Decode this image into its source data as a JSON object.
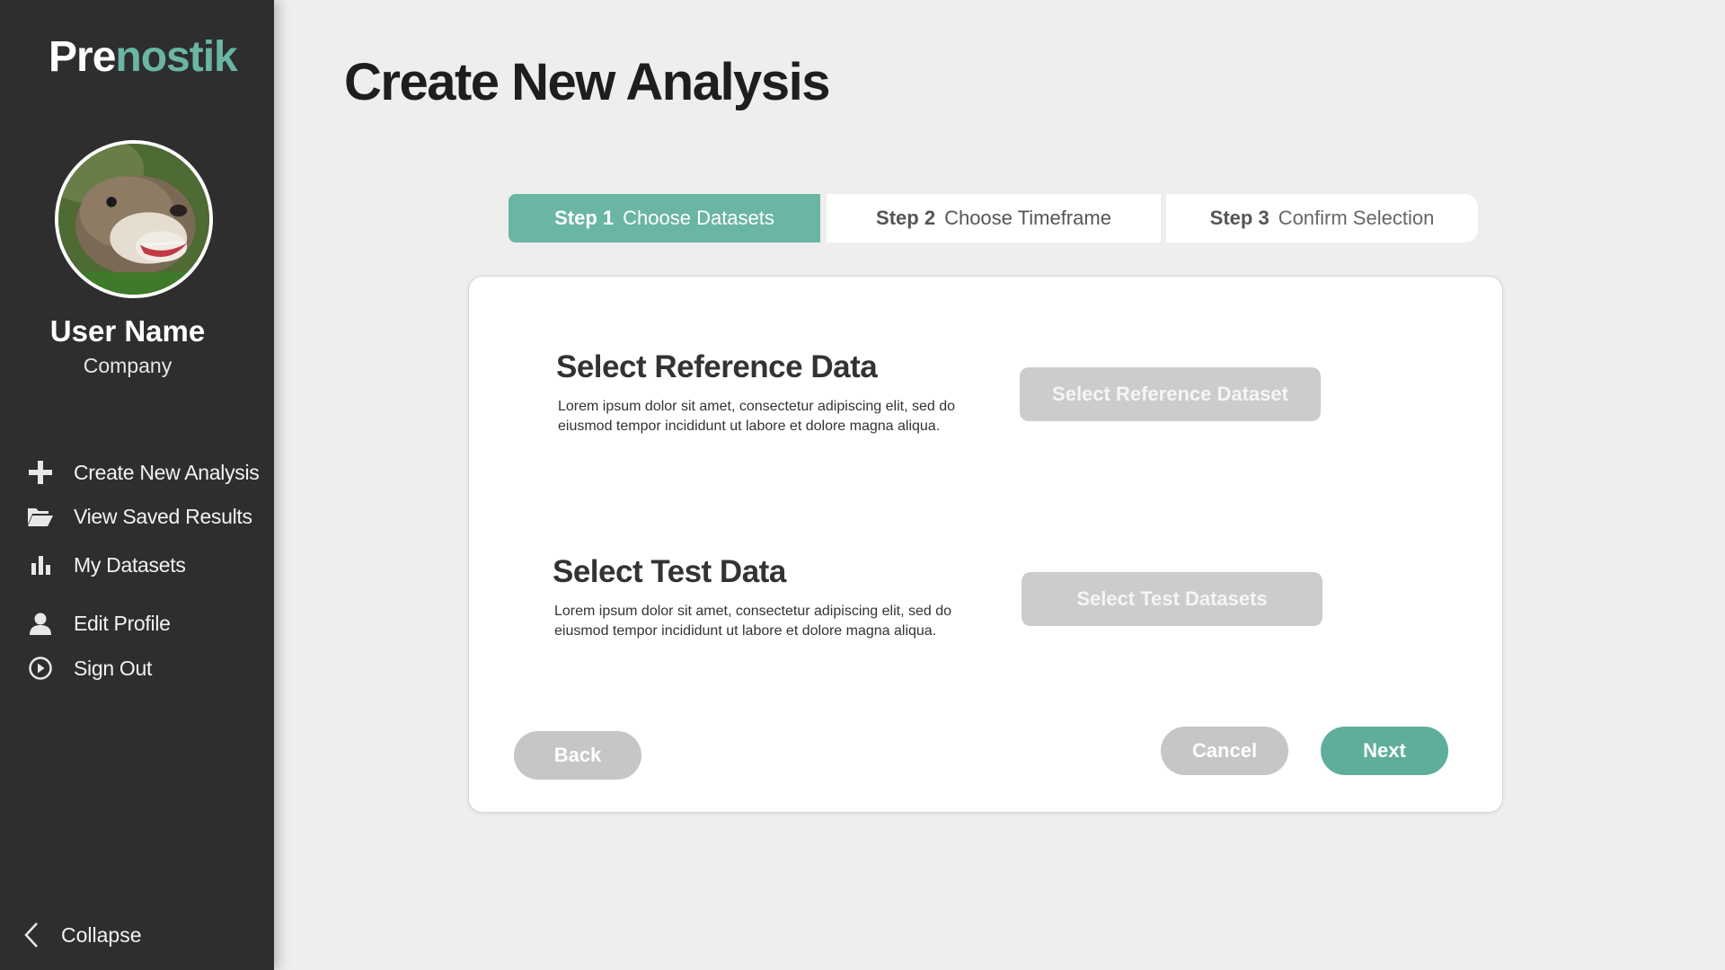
{
  "app": {
    "logo_prefix": "Pre",
    "logo_suffix": "nostik"
  },
  "colors": {
    "accent": "#6ab5a4",
    "sidebar_bg": "#2e2e2e",
    "page_bg": "#eeeeee",
    "disabled_button": "#cccccc"
  },
  "user": {
    "name": "User Name",
    "company": "Company"
  },
  "sidebar": {
    "items": [
      {
        "label": "Create New Analysis",
        "icon": "plus-icon"
      },
      {
        "label": "View Saved Results",
        "icon": "folder-open-icon"
      },
      {
        "label": "My Datasets",
        "icon": "bar-chart-icon"
      },
      {
        "label": "Edit Profile",
        "icon": "user-icon"
      },
      {
        "label": "Sign Out",
        "icon": "sign-out-icon"
      }
    ],
    "collapse_label": "Collapse",
    "collapse_icon": "chevron-left-icon"
  },
  "page": {
    "title": "Create New Analysis"
  },
  "steps": [
    {
      "number": "Step 1",
      "label": "Choose Datasets",
      "active": true
    },
    {
      "number": "Step 2",
      "label": "Choose Timeframe",
      "active": false
    },
    {
      "number": "Step 3",
      "label": "Confirm Selection",
      "active": false
    }
  ],
  "reference": {
    "title": "Select Reference Data",
    "description_line1": "Lorem ipsum dolor sit amet, consectetur adipiscing elit, sed do",
    "description_line2": "eiusmod tempor incididunt ut labore et dolore magna aliqua.",
    "button_label": "Select Reference Dataset"
  },
  "test": {
    "title": "Select Test Data",
    "description_line1": "Lorem ipsum dolor sit amet, consectetur adipiscing elit, sed do",
    "description_line2": "eiusmod tempor incididunt ut labore et dolore magna aliqua.",
    "button_label": "Select Test Datasets"
  },
  "actions": {
    "back_label": "Back",
    "cancel_label": "Cancel",
    "next_label": "Next"
  }
}
